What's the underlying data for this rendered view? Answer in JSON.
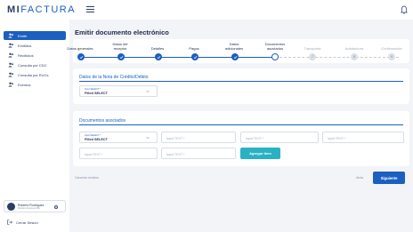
{
  "app": {
    "logo_bold": "MI",
    "logo_light": "FACTURA"
  },
  "sidebar": {
    "items": [
      {
        "label": "Emitir",
        "active": true,
        "icon": "users-icon"
      },
      {
        "label": "Emitidos",
        "active": false,
        "icon": "users-icon"
      },
      {
        "label": "Recibidos",
        "active": false,
        "icon": "users-icon"
      },
      {
        "label": "Consulta por CDC",
        "active": false,
        "icon": "users-icon"
      },
      {
        "label": "Consulta por RUCs",
        "active": false,
        "icon": "users-icon"
      },
      {
        "label": "Eventos",
        "active": false,
        "icon": "users-icon"
      }
    ],
    "user": {
      "name": "Roberto Rodriguez",
      "subtitle": "Nombre Empresa SRL"
    },
    "logout_label": "Cerrar Sesión"
  },
  "page": {
    "title": "Emitir documento electrónico"
  },
  "stepper": {
    "steps": [
      {
        "label": "Datos generales",
        "state": "done"
      },
      {
        "label": "Datos del receptor",
        "state": "done"
      },
      {
        "label": "Detalles",
        "state": "done"
      },
      {
        "label": "Pagos",
        "state": "done"
      },
      {
        "label": "Datos adicionales",
        "state": "done"
      },
      {
        "label": "Documentos asociados",
        "state": "current"
      },
      {
        "label": "Transporte",
        "state": "todo",
        "number": "7"
      },
      {
        "label": "Autofactura",
        "state": "todo",
        "number": "8"
      },
      {
        "label": "Confirmación",
        "state": "todo",
        "number": "9"
      }
    ]
  },
  "nota": {
    "title": "Datos de la Nota de Crédito/Débito",
    "select": {
      "label": "Input SELECT *",
      "value": "Filled SELECT"
    }
  },
  "docs": {
    "title": "Documentos asociados",
    "select": {
      "label": "Input SELECT *",
      "value": "Filled SELECT"
    },
    "inputs_row1": [
      "Input TEXT *",
      "Input TEXT *",
      "Input TEXT *"
    ],
    "inputs_row2": [
      "Input TEXT *",
      "Input TEXT *"
    ],
    "add_button": "Agregar Item"
  },
  "footer": {
    "cancel_label": "Cancelar emision",
    "back_label": "Atrás",
    "next_label": "Siguiente"
  },
  "colors": {
    "primary": "#1b5fc1",
    "teal": "#2ab1c4",
    "background": "#f2f4f8"
  }
}
